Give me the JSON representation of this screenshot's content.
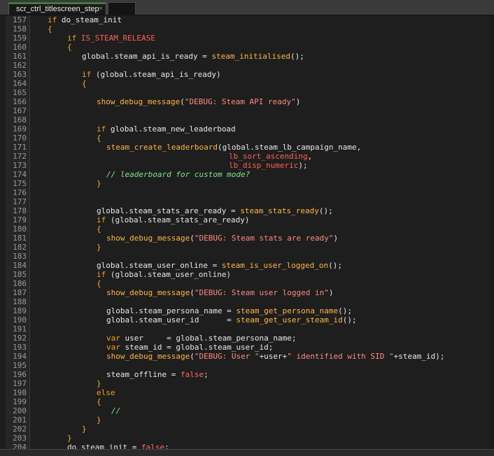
{
  "tab": {
    "title": "scr_ctrl_titlescreen_step",
    "close": "×"
  },
  "lines": [
    {
      "n": "157",
      "indent": 4,
      "tokens": [
        [
          "kw",
          "if"
        ],
        [
          "plain",
          " do_steam_init"
        ]
      ]
    },
    {
      "n": "158",
      "indent": 4,
      "tokens": [
        [
          "br",
          "{"
        ]
      ]
    },
    {
      "n": "159",
      "indent": 8,
      "tokens": [
        [
          "kw",
          "if"
        ],
        [
          "plain",
          " "
        ],
        [
          "cst",
          "IS_STEAM_RELEASE"
        ]
      ]
    },
    {
      "n": "160",
      "indent": 8,
      "tokens": [
        [
          "br",
          "{"
        ]
      ]
    },
    {
      "n": "161",
      "indent": 11,
      "tokens": [
        [
          "plain",
          "global.steam_api_is_ready = "
        ],
        [
          "fn",
          "steam_initialised"
        ],
        [
          "plain",
          "();"
        ]
      ]
    },
    {
      "n": "162",
      "indent": 0,
      "tokens": []
    },
    {
      "n": "163",
      "indent": 11,
      "tokens": [
        [
          "kw",
          "if"
        ],
        [
          "plain",
          " (global.steam_api_is_ready)"
        ]
      ]
    },
    {
      "n": "164",
      "indent": 11,
      "tokens": [
        [
          "br",
          "{"
        ]
      ]
    },
    {
      "n": "165",
      "indent": 0,
      "tokens": []
    },
    {
      "n": "166",
      "indent": 14,
      "tokens": [
        [
          "fn",
          "show_debug_message"
        ],
        [
          "plain",
          "("
        ],
        [
          "str",
          "\"DEBUG: Steam API ready\""
        ],
        [
          "plain",
          ")"
        ]
      ]
    },
    {
      "n": "167",
      "indent": 0,
      "tokens": []
    },
    {
      "n": "168",
      "indent": 0,
      "tokens": []
    },
    {
      "n": "169",
      "indent": 14,
      "tokens": [
        [
          "kw",
          "if"
        ],
        [
          "plain",
          " global.steam_new_leaderboad"
        ]
      ]
    },
    {
      "n": "170",
      "indent": 14,
      "tokens": [
        [
          "br",
          "{"
        ]
      ]
    },
    {
      "n": "171",
      "indent": 16,
      "tokens": [
        [
          "fn",
          "steam_create_leaderboard"
        ],
        [
          "plain",
          "(global.steam_lb_campaign_name,"
        ]
      ]
    },
    {
      "n": "172",
      "indent": 41,
      "tokens": [
        [
          "cst",
          "lb_sort_ascending"
        ],
        [
          "plain",
          ","
        ]
      ]
    },
    {
      "n": "173",
      "indent": 41,
      "tokens": [
        [
          "cst",
          "lb_disp_numeric"
        ],
        [
          "plain",
          ");"
        ]
      ]
    },
    {
      "n": "174",
      "indent": 16,
      "tokens": [
        [
          "cm",
          "// leaderboard for custom mode?"
        ]
      ]
    },
    {
      "n": "175",
      "indent": 14,
      "tokens": [
        [
          "br",
          "}"
        ]
      ]
    },
    {
      "n": "176",
      "indent": 0,
      "tokens": []
    },
    {
      "n": "177",
      "indent": 0,
      "tokens": []
    },
    {
      "n": "178",
      "indent": 14,
      "tokens": [
        [
          "plain",
          "global.steam_stats_are_ready = "
        ],
        [
          "fn",
          "steam_stats_ready"
        ],
        [
          "plain",
          "();"
        ]
      ]
    },
    {
      "n": "179",
      "indent": 14,
      "tokens": [
        [
          "kw",
          "if"
        ],
        [
          "plain",
          " (global.steam_stats_are_ready)"
        ]
      ]
    },
    {
      "n": "180",
      "indent": 14,
      "tokens": [
        [
          "br",
          "{"
        ]
      ]
    },
    {
      "n": "181",
      "indent": 16,
      "tokens": [
        [
          "fn",
          "show_debug_message"
        ],
        [
          "plain",
          "("
        ],
        [
          "str",
          "\"DEBUG: Steam stats are ready\""
        ],
        [
          "plain",
          ")"
        ]
      ]
    },
    {
      "n": "182",
      "indent": 14,
      "tokens": [
        [
          "br",
          "}"
        ]
      ]
    },
    {
      "n": "183",
      "indent": 0,
      "tokens": []
    },
    {
      "n": "184",
      "indent": 14,
      "tokens": [
        [
          "plain",
          "global.steam_user_online = "
        ],
        [
          "fn",
          "steam_is_user_logged_on"
        ],
        [
          "plain",
          "();"
        ]
      ]
    },
    {
      "n": "185",
      "indent": 14,
      "tokens": [
        [
          "kw",
          "if"
        ],
        [
          "plain",
          " (global.steam_user_online)"
        ]
      ]
    },
    {
      "n": "186",
      "indent": 14,
      "tokens": [
        [
          "br",
          "{"
        ]
      ]
    },
    {
      "n": "187",
      "indent": 16,
      "tokens": [
        [
          "fn",
          "show_debug_message"
        ],
        [
          "plain",
          "("
        ],
        [
          "str",
          "\"DEBUG: Steam user logged in\""
        ],
        [
          "plain",
          ")"
        ]
      ]
    },
    {
      "n": "188",
      "indent": 0,
      "tokens": []
    },
    {
      "n": "189",
      "indent": 16,
      "tokens": [
        [
          "plain",
          "global.steam_persona_name = "
        ],
        [
          "fn",
          "steam_get_persona_name"
        ],
        [
          "plain",
          "();"
        ]
      ]
    },
    {
      "n": "190",
      "indent": 16,
      "tokens": [
        [
          "plain",
          "global.steam_user_id      = "
        ],
        [
          "fn",
          "steam_get_user_steam_id"
        ],
        [
          "plain",
          "();"
        ]
      ]
    },
    {
      "n": "191",
      "indent": 0,
      "tokens": []
    },
    {
      "n": "192",
      "indent": 16,
      "tokens": [
        [
          "kw",
          "var"
        ],
        [
          "plain",
          " user     = global.steam_persona_name;"
        ]
      ]
    },
    {
      "n": "193",
      "indent": 16,
      "tokens": [
        [
          "kw",
          "var"
        ],
        [
          "plain",
          " steam_id = global.steam_user_id;"
        ]
      ]
    },
    {
      "n": "194",
      "indent": 16,
      "tokens": [
        [
          "fn",
          "show_debug_message"
        ],
        [
          "plain",
          "("
        ],
        [
          "str",
          "\"DEBUG: User \""
        ],
        [
          "plain",
          "+user+"
        ],
        [
          "str",
          "\" identified with SID \""
        ],
        [
          "plain",
          "+steam_id);"
        ]
      ]
    },
    {
      "n": "195",
      "indent": 0,
      "tokens": []
    },
    {
      "n": "196",
      "indent": 16,
      "tokens": [
        [
          "plain",
          "steam_offline = "
        ],
        [
          "bool",
          "false"
        ],
        [
          "plain",
          ";"
        ]
      ]
    },
    {
      "n": "197",
      "indent": 14,
      "tokens": [
        [
          "br",
          "}"
        ]
      ]
    },
    {
      "n": "198",
      "indent": 14,
      "tokens": [
        [
          "kw",
          "else"
        ]
      ]
    },
    {
      "n": "199",
      "indent": 14,
      "tokens": [
        [
          "br",
          "{"
        ]
      ]
    },
    {
      "n": "200",
      "indent": 17,
      "tokens": [
        [
          "cm",
          "//"
        ]
      ]
    },
    {
      "n": "201",
      "indent": 14,
      "tokens": [
        [
          "br",
          "}"
        ]
      ]
    },
    {
      "n": "202",
      "indent": 11,
      "tokens": [
        [
          "br",
          "}"
        ]
      ]
    },
    {
      "n": "203",
      "indent": 8,
      "tokens": [
        [
          "br",
          "}"
        ]
      ]
    },
    {
      "n": "204",
      "indent": 8,
      "tokens": [
        [
          "plain",
          "do_steam_init = "
        ],
        [
          "bool",
          "false"
        ],
        [
          "plain",
          ";"
        ]
      ]
    }
  ]
}
